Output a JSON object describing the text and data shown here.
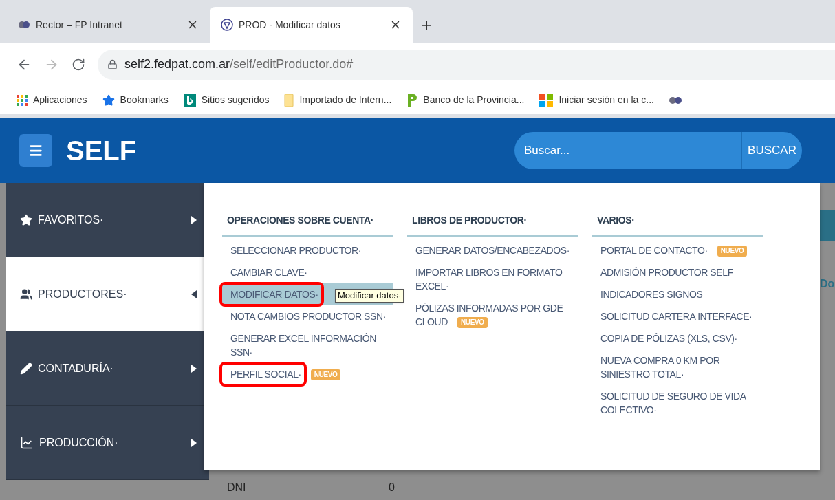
{
  "browser": {
    "tabs": [
      {
        "title": "Rector – FP Intranet",
        "selected": false
      },
      {
        "title": "PROD - Modificar datos",
        "selected": true
      }
    ],
    "new_tab": "+",
    "url_host": "self2.fedpat.com.ar",
    "url_path": "/self/editProductor.do#"
  },
  "bookmarks": [
    {
      "label": "Aplicaciones",
      "kind": "apps"
    },
    {
      "label": "Bookmarks",
      "kind": "star"
    },
    {
      "label": "Sitios sugeridos",
      "kind": "bing"
    },
    {
      "label": "Importado de Intern...",
      "kind": "folder"
    },
    {
      "label": "Banco de la Provincia...",
      "kind": "bank"
    },
    {
      "label": "Iniciar sesión en la c...",
      "kind": "windows"
    },
    {
      "kind": "logo"
    }
  ],
  "header": {
    "brand": "SELF",
    "search": {
      "placeholder": "Buscar..."
    },
    "search_button": "BUSCAR"
  },
  "sidebar": [
    {
      "label": "FAVORITOS·",
      "kind": "star",
      "expanded": false
    },
    {
      "label": "PRODUCTORES·",
      "kind": "users",
      "expanded": true
    },
    {
      "label": "CONTADURÍA·",
      "kind": "pencil",
      "expanded": false
    },
    {
      "label": "PRODUCCIÓN·",
      "kind": "chart",
      "expanded": false
    }
  ],
  "menu": [
    {
      "title": "OPERACIONES SOBRE CUENTA·",
      "items": [
        {
          "label": "SELECCIONAR PRODUCTOR·",
          "selected": false,
          "annotated": false
        },
        {
          "label": "CAMBIAR CLAVE·",
          "selected": false,
          "annotated": false
        },
        {
          "label": "MODIFICAR DATOS·",
          "selected": true,
          "annotated": true,
          "tooltip": "Modificar datos·"
        },
        {
          "label": "NOTA CAMBIOS PRODUCTOR SSN·",
          "selected": false,
          "annotated": false
        },
        {
          "label": "GENERAR EXCEL INFORMACIÓN SSN·",
          "selected": false,
          "annotated": false
        },
        {
          "label": "PERFIL SOCIAL·",
          "selected": false,
          "annotated": true,
          "badge": "NUEVO"
        }
      ]
    },
    {
      "title": "LIBROS DE PRODUCTOR·",
      "items": [
        {
          "label": "GENERAR DATOS/ENCABEZADOS·",
          "selected": false,
          "annotated": false
        },
        {
          "label": "IMPORTAR LIBROS EN FORMATO EXCEL·",
          "selected": false,
          "annotated": false
        },
        {
          "label": "PÓLIZAS INFORMADAS POR GDE CLOUD",
          "selected": false,
          "annotated": false,
          "badge": "NUEVO"
        }
      ]
    },
    {
      "title": "VARIOS·",
      "items": [
        {
          "label": "PORTAL DE CONTACTO·",
          "selected": false,
          "annotated": false,
          "badge": "NUEVO"
        },
        {
          "label": "ADMISIÓN PRODUCTOR SELF",
          "selected": false,
          "annotated": false
        },
        {
          "label": "INDICADORES SIGNOS",
          "selected": false,
          "annotated": false
        },
        {
          "label": "SOLICITUD CARTERA INTERFACE·",
          "selected": false,
          "annotated": false
        },
        {
          "label": "COPIA DE PÓLIZAS (XLS, CSV)·",
          "selected": false,
          "annotated": false
        },
        {
          "label": "NUEVA COMPRA 0 KM POR SINIESTRO TOTAL·",
          "selected": false,
          "annotated": false
        },
        {
          "label": "SOLICITUD DE SEGURO DE VIDA COLECTIVO·",
          "selected": false,
          "annotated": false
        }
      ]
    }
  ],
  "background": {
    "heading": "Do",
    "field_label": "DNI",
    "field_value": "0"
  }
}
